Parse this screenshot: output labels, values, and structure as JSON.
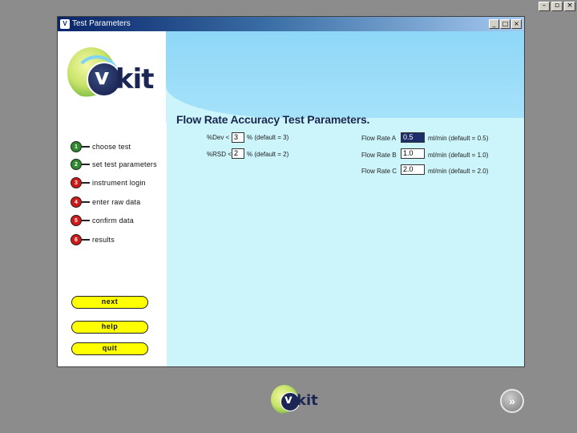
{
  "screen": {
    "controls": [
      "–",
      "▫",
      "×"
    ]
  },
  "window": {
    "title": "Test Parameters",
    "icon_glyph": "V",
    "controls": {
      "minimize": "_",
      "maximize": "□",
      "close": "×"
    }
  },
  "logo": {
    "v": "v",
    "kit": "kit"
  },
  "steps": [
    {
      "num": "1",
      "label": "choose test",
      "state": "complete"
    },
    {
      "num": "2",
      "label": "set test parameters",
      "state": "current"
    },
    {
      "num": "3",
      "label": "instrument login",
      "state": "pending"
    },
    {
      "num": "4",
      "label": "enter raw data",
      "state": "pending"
    },
    {
      "num": "5",
      "label": "confirm data",
      "state": "pending"
    },
    {
      "num": "6",
      "label": "results",
      "state": "pending"
    }
  ],
  "buttons": {
    "next": "next",
    "help": "help",
    "quit": "quit"
  },
  "form": {
    "heading": "Flow Rate Accuracy Test Parameters.",
    "dev": {
      "label": "%Dev <",
      "value": "3",
      "suffix": "% (default = 3)"
    },
    "rsd": {
      "label": "%RSD <",
      "value": "2",
      "suffix": "% (default = 2)"
    },
    "flow_a": {
      "label": "Flow Rate A",
      "value": "0.5",
      "suffix": "ml/min (default = 0.5)"
    },
    "flow_b": {
      "label": "Flow Rate B",
      "value": "1.0",
      "suffix": "ml/min (default = 1.0)"
    },
    "flow_c": {
      "label": "Flow Rate C",
      "value": "2.0",
      "suffix": "ml/min (default = 2.0)"
    }
  },
  "bottom": {
    "forward_glyph": "»"
  },
  "colors": {
    "accent": "#ccf5fb",
    "button": "#ffff00",
    "complete": "#2f8a2f",
    "pending": "#d01818"
  }
}
